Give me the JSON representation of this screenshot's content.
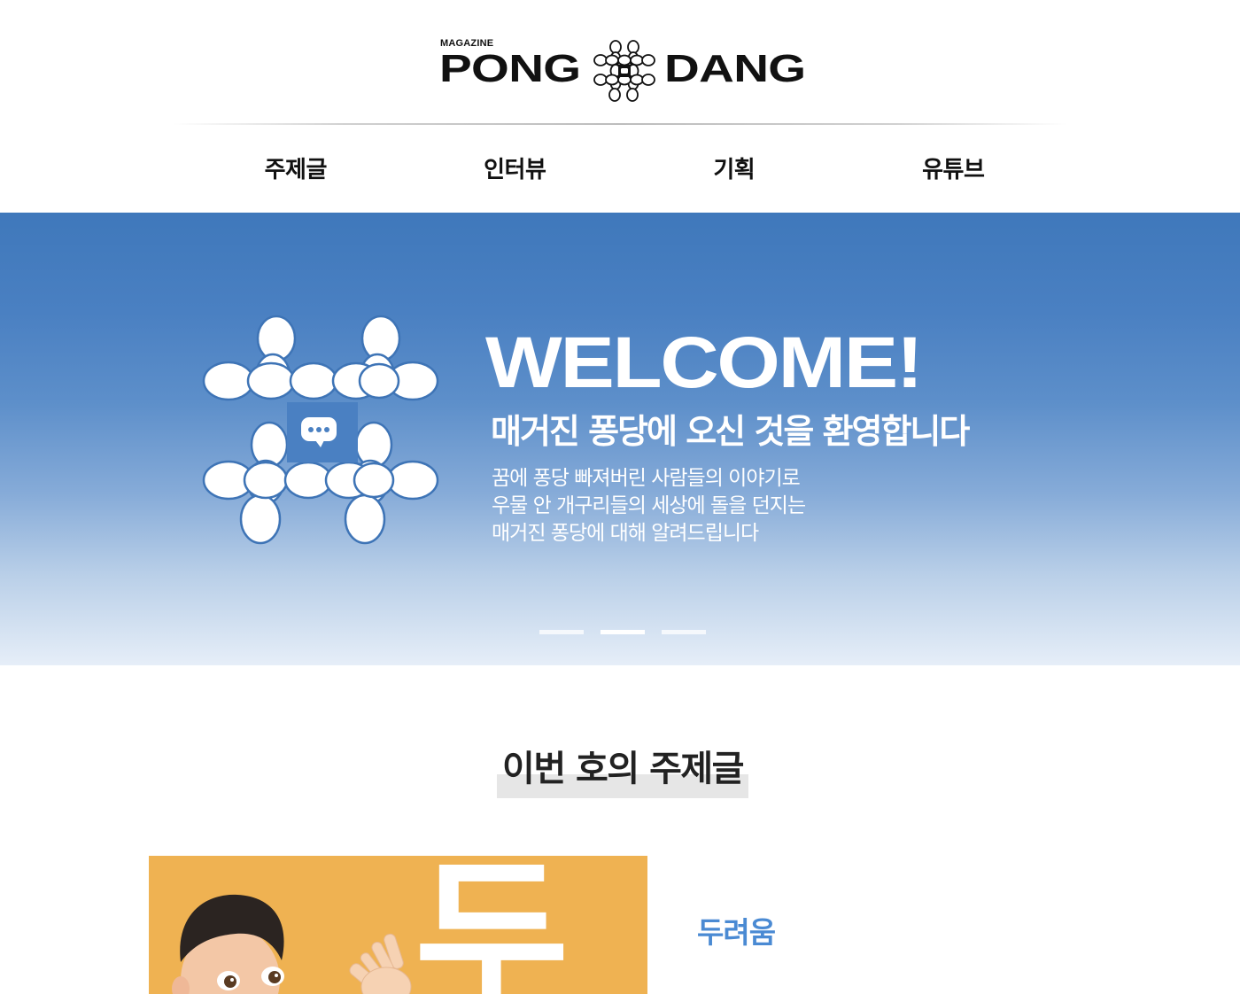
{
  "header": {
    "logo": {
      "small": "MAGAZINE",
      "left": "PONG",
      "right": "DANG",
      "mark_icon": "hash-bubble-icon"
    },
    "nav": [
      {
        "label": "주제글"
      },
      {
        "label": "인터뷰"
      },
      {
        "label": "기획"
      },
      {
        "label": "유튜브"
      }
    ]
  },
  "hero": {
    "icon": "hash-chat-bubble-icon",
    "welcome": "WELCOME!",
    "subtitle": "매거진 퐁당에 오신 것을 환영합니다",
    "description": [
      "꿈에 퐁당 빠져버린 사람들의 이야기로",
      "우물 안 개구리들의 세상에 돌을 던지는",
      "매거진 퐁당에 대해 알려드립니다"
    ],
    "slides": {
      "count": 3,
      "active": 2
    },
    "colors": {
      "top": "#3f78bb",
      "bottom": "#e6eef8"
    }
  },
  "section": {
    "title": "이번 호의 주제글",
    "topic": {
      "image_icon": "memoji-boy-waving-image",
      "image_text": "두",
      "link": "두려움",
      "link_color": "#4a8ad3",
      "card_color": "#efb252"
    }
  }
}
